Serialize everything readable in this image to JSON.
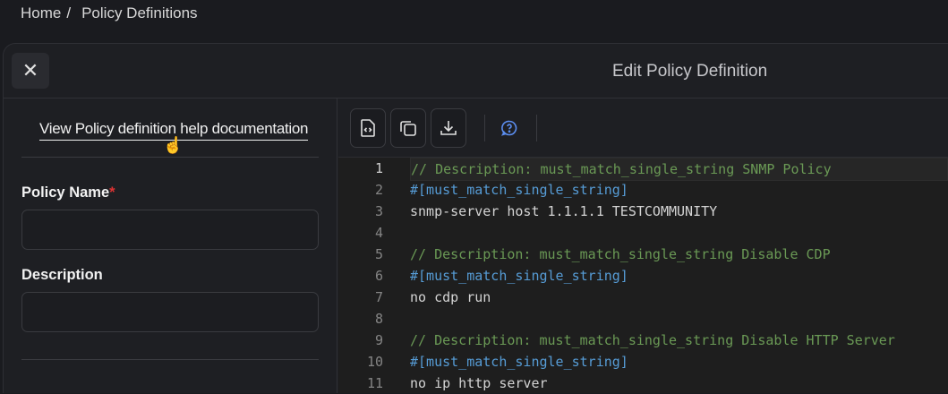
{
  "breadcrumb": {
    "home": "Home",
    "separator": "/",
    "current": "Policy Definitions"
  },
  "modal": {
    "title": "Edit Policy Definition",
    "close_icon": "close-icon"
  },
  "form": {
    "help_link": "View Policy definition help documentation",
    "policy_name_label": "Policy Name",
    "required_mark": "*",
    "policy_name_value": "",
    "description_label": "Description",
    "description_value": ""
  },
  "toolbar": {
    "buttons": [
      "format-code-icon",
      "copy-icon",
      "download-icon",
      "help-icon"
    ]
  },
  "editor": {
    "lines": [
      {
        "n": "1",
        "type": "comment",
        "text": "// Description: must_match_single_string SNMP Policy"
      },
      {
        "n": "2",
        "type": "attr",
        "text": "#[must_match_single_string]"
      },
      {
        "n": "3",
        "type": "plain",
        "text": "snmp-server host 1.1.1.1 TESTCOMMUNITY"
      },
      {
        "n": "4",
        "type": "plain",
        "text": ""
      },
      {
        "n": "5",
        "type": "comment",
        "text": "// Description: must_match_single_string Disable CDP"
      },
      {
        "n": "6",
        "type": "attr",
        "text": "#[must_match_single_string]"
      },
      {
        "n": "7",
        "type": "plain",
        "text": "no cdp run"
      },
      {
        "n": "8",
        "type": "plain",
        "text": ""
      },
      {
        "n": "9",
        "type": "comment",
        "text": "// Description: must_match_single_string Disable HTTP Server"
      },
      {
        "n": "10",
        "type": "attr",
        "text": "#[must_match_single_string]"
      },
      {
        "n": "11",
        "type": "plain",
        "text": "no ip http server"
      }
    ]
  },
  "colors": {
    "comment": "#6a9955",
    "attribute": "#569cd6",
    "accent": "#5b8def",
    "required": "#dd3333"
  }
}
